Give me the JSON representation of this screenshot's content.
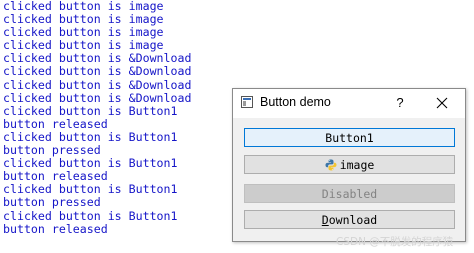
{
  "console": {
    "lines": [
      "clicked button is image",
      "clicked button is image",
      "clicked button is image",
      "clicked button is image",
      "clicked button is &Download",
      "clicked button is &Download",
      "clicked button is &Download",
      "clicked button is &Download",
      "clicked button is Button1",
      "button released",
      "clicked button is Button1",
      "button pressed",
      "clicked button is Button1",
      "button released",
      "clicked button is Button1",
      "button pressed",
      "clicked button is Button1",
      "button released"
    ],
    "text_color": "#1515c8"
  },
  "window": {
    "title": "Button demo",
    "help_label": "?",
    "icons": {
      "app": "app-window-icon",
      "close": "close-icon"
    }
  },
  "buttons": {
    "button1": "Button1",
    "image": "image",
    "image_icon": "python-icon",
    "disabled": "Disabled",
    "download_mnemonic": "D",
    "download_rest": "ownload"
  },
  "watermark": "CSDN @不脱发的程序猿",
  "colors": {
    "focus_border": "#0078d7",
    "button_bg": "#e1e1e1",
    "disabled_text": "#838383"
  }
}
